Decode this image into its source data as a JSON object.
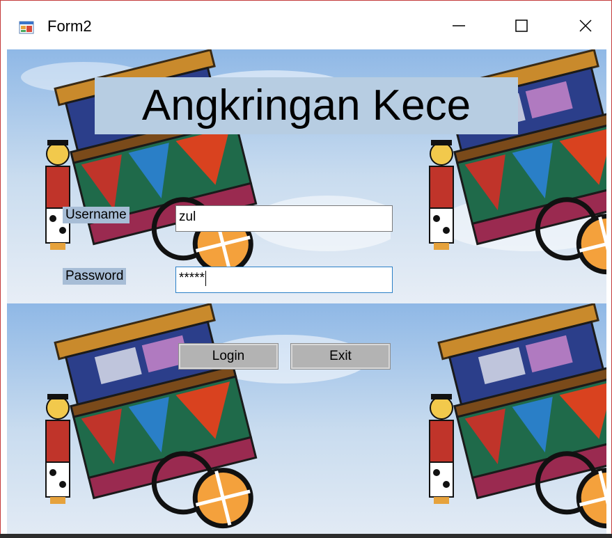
{
  "window": {
    "title": "Form2",
    "controls": {
      "minimize_icon": "minimize-icon",
      "maximize_icon": "maximize-icon",
      "close_icon": "close-icon"
    }
  },
  "form": {
    "heading": "Angkringan Kece",
    "username_label": "Username",
    "username_value": "zul",
    "password_label": "Password",
    "password_value": "*****",
    "login_label": "Login",
    "exit_label": "Exit"
  },
  "background": {
    "description_icon": "angkringan-cart-illustration",
    "sky_color": "#9fc4ea"
  },
  "colors": {
    "heading_bg": "#b7cde2",
    "label_bg": "#a7bdd6",
    "button_bg": "#b3b3b3",
    "focus_border": "#2a7fc7",
    "window_border": "#c33a3a"
  }
}
